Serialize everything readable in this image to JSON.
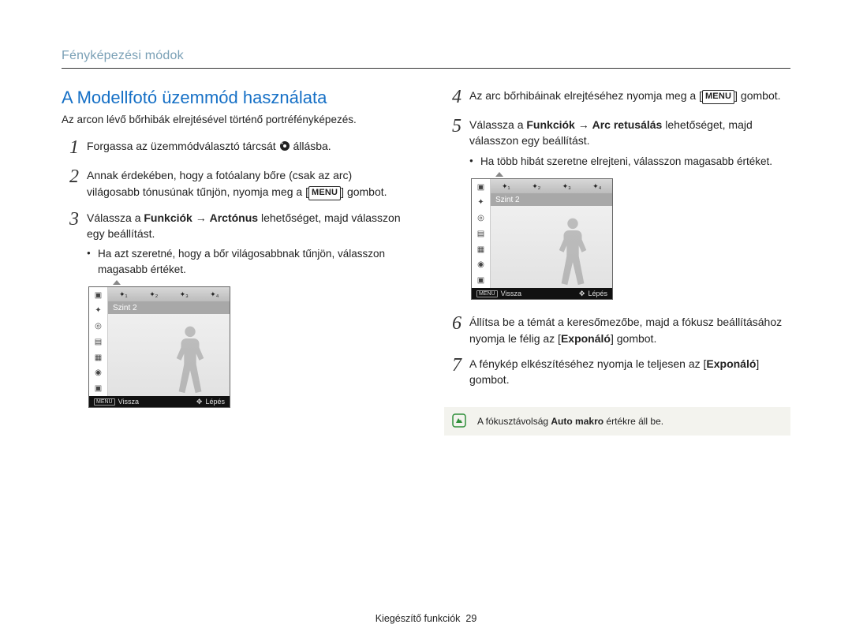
{
  "breadcrumb": "Fényképezési módok",
  "title": "A Modellfotó üzemmód használata",
  "intro": "Az arcon lévő bőrhibák elrejtésével történő portréfényképezés.",
  "left_steps": {
    "s1": {
      "num": "1",
      "pre": "Forgassa az üzemmódválasztó tárcsát ",
      "post": " állásba."
    },
    "s2": {
      "num": "2",
      "a": "Annak érdekében, hogy a fotóalany bőre (csak az arc) világosabb tónusúnak tűnjön, nyomja meg a ",
      "menu": "MENU",
      "b": " gombot."
    },
    "s3": {
      "num": "3",
      "a": "Válassza a ",
      "b1": "Funkciók",
      "arrow": " → ",
      "b2": "Arctónus",
      "c": " lehetőséget, majd válasszon egy beállítást.",
      "sub": "Ha azt szeretné, hogy a bőr világosabbnak tűnjön, válasszon magasabb értéket."
    }
  },
  "right_steps": {
    "s4": {
      "num": "4",
      "a": "Az arc bőrhibáinak elrejtéséhez nyomja meg a ",
      "menu": "MENU",
      "b": " gombot."
    },
    "s5": {
      "num": "5",
      "a": "Válassza a ",
      "b1": "Funkciók",
      "arrow": " → ",
      "b2": "Arc retusálás",
      "c": " lehetőséget, majd válasszon egy beállítást.",
      "sub": "Ha több hibát szeretne elrejteni, válasszon magasabb értéket."
    },
    "s6": {
      "num": "6",
      "a": "Állítsa be a témát a keresőmezőbe, majd a fókusz beállításához nyomja le félig az [",
      "b": "Exponáló",
      "c": "] gombot."
    },
    "s7": {
      "num": "7",
      "a": "A fénykép elkészítéséhez nyomja le teljesen az [",
      "b": "Exponáló",
      "c": "] gombot."
    }
  },
  "shot": {
    "topbar": [
      "⬛",
      "⬛",
      "⬛",
      "⬛"
    ],
    "label": "Szint 2",
    "foot_left_badge": "MENU",
    "foot_left": "Vissza",
    "foot_right": "Lépés"
  },
  "note": {
    "a": "A fókusztávolság ",
    "b": "Auto makro",
    "c": " értékre áll be."
  },
  "footer": {
    "label": "Kiegészítő funkciók",
    "page": "29"
  }
}
